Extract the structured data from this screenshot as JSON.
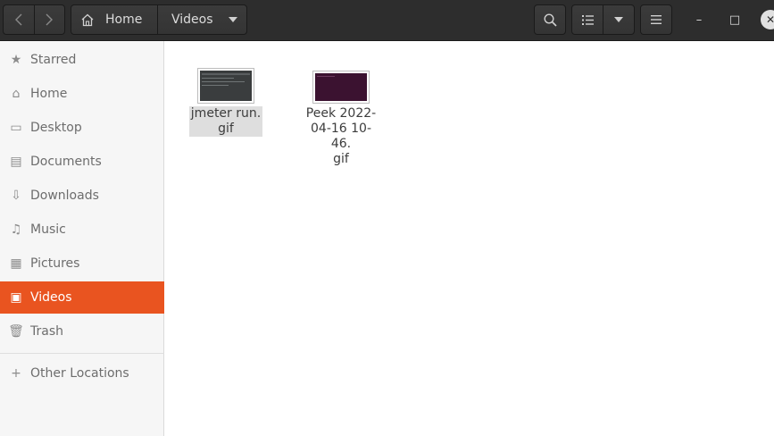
{
  "header": {
    "back_icon": "chevron-left",
    "forward_icon": "chevron-right",
    "path": [
      {
        "label": "Home",
        "icon": "home-icon"
      },
      {
        "label": "Videos"
      }
    ],
    "search_icon": "magnifier",
    "view_icon": "list-view",
    "menu_icon": "hamburger",
    "window": {
      "minimize": "–",
      "maximize": "□",
      "close": "✕"
    }
  },
  "sidebar": {
    "items": [
      {
        "label": "Starred",
        "icon": "★"
      },
      {
        "label": "Home",
        "icon": "⌂"
      },
      {
        "label": "Desktop",
        "icon": "▭"
      },
      {
        "label": "Documents",
        "icon": "▤"
      },
      {
        "label": "Downloads",
        "icon": "⇩"
      },
      {
        "label": "Music",
        "icon": "♫"
      },
      {
        "label": "Pictures",
        "icon": "▦"
      },
      {
        "label": "Videos",
        "icon": "▣",
        "active": true
      },
      {
        "label": "Trash",
        "icon": "🗑"
      }
    ],
    "other": {
      "label": "Other Locations",
      "icon": "+"
    }
  },
  "files": [
    {
      "name_line1": "jmeter run.",
      "name_line2": "gif",
      "name_line3": "",
      "selected": true,
      "thumb_color": "#3a3d3e"
    },
    {
      "name_line1": "Peek 2022-",
      "name_line2": "04-16 10-46.",
      "name_line3": "gif",
      "selected": false,
      "thumb_color": "#3b1230"
    }
  ],
  "colors": {
    "accent": "#e95420",
    "headerbar": "#2d2d2d"
  }
}
